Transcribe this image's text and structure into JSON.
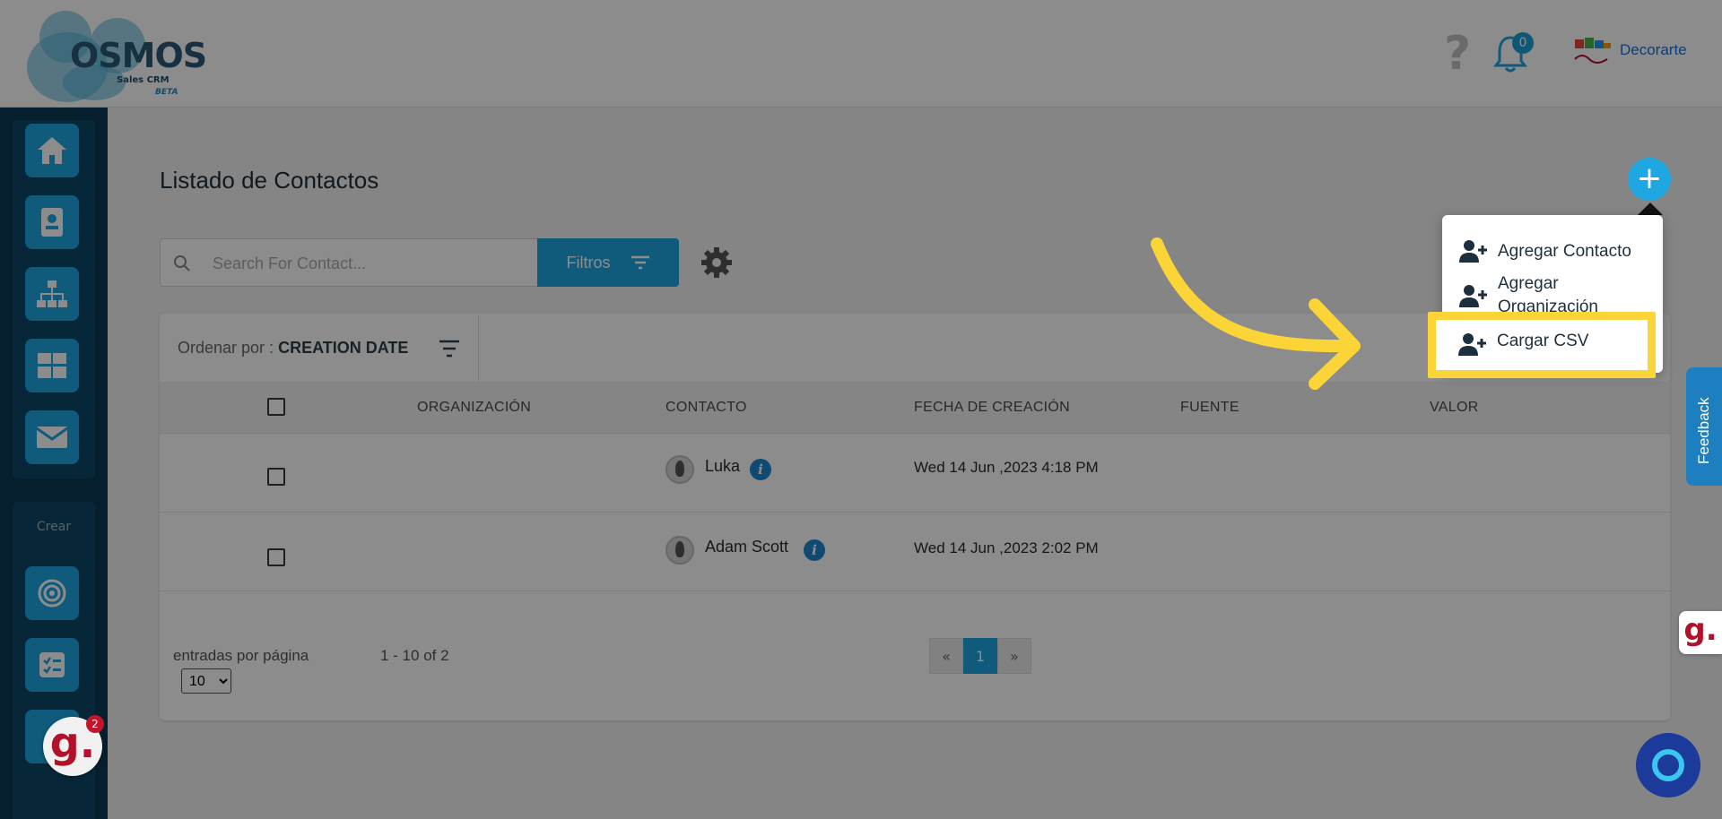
{
  "header": {
    "logo_word": "OSMOS",
    "logo_sub": "Sales CRM",
    "logo_beta": "BETA",
    "help_glyph": "?",
    "notifications_count": "0",
    "brand_name": "Decorarte"
  },
  "sidebar": {
    "top_icons": [
      "home-icon",
      "contact-card-icon",
      "org-chart-icon",
      "grid-icon",
      "mail-icon"
    ],
    "section_label": "Crear",
    "bottom_icons": [
      "target-icon",
      "checklist-icon"
    ]
  },
  "page": {
    "title": "Listado de Contactos",
    "search_placeholder": "Search For Contact...",
    "filter_label": "Filtros",
    "sort_prefix": "Ordenar por :",
    "sort_value": "CREATION DATE"
  },
  "table": {
    "headers": [
      "ORGANIZACIÓN",
      "CONTACTO",
      "FECHA DE CREACIÓN",
      "FUENTE",
      "VALOR"
    ],
    "rows": [
      {
        "organization": "",
        "contact": "Luka",
        "created": "Wed 14 Jun ,2023 4:18 PM",
        "source": "",
        "value": ""
      },
      {
        "organization": "",
        "contact": "Adam Scott",
        "created": "Wed 14 Jun ,2023 2:02 PM",
        "source": "",
        "value": ""
      }
    ]
  },
  "footer": {
    "per_page_label": "entradas por página",
    "per_page_value": "10",
    "range": "1 - 10 of 2",
    "pager": {
      "prev": "«",
      "current": "1",
      "next": "»"
    }
  },
  "menu": {
    "open_glyph": "+",
    "items": [
      "Agregar Contacto",
      "Agregar Organización",
      "Cargar CSV"
    ]
  },
  "widgets": {
    "feedback_label": "Feedback",
    "g_logo": "g.",
    "g_badge": "2"
  },
  "colors": {
    "accent": "#1ea7e0",
    "sidebar": "#0b3a57",
    "highlight": "#fbd437"
  }
}
